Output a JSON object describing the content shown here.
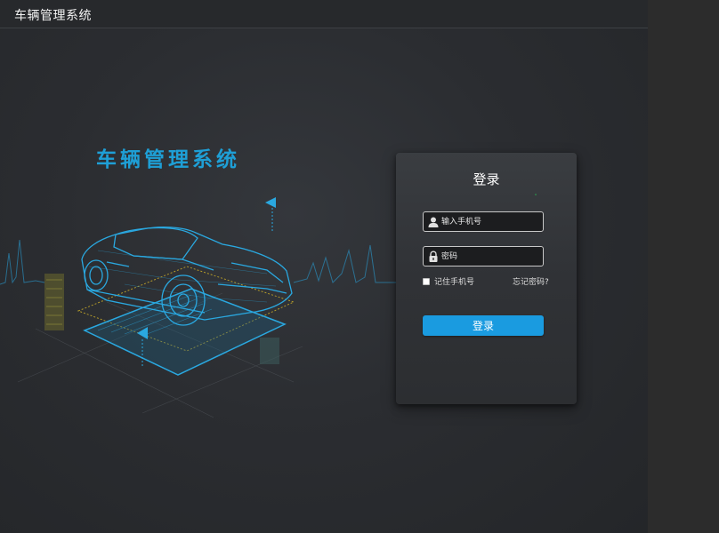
{
  "topbar": {
    "title": "车辆管理系统"
  },
  "hero": {
    "title": "车辆管理系统"
  },
  "login": {
    "title": "登录",
    "phone_placeholder": "输入手机号",
    "password_placeholder": "密码",
    "remember_label": "记住手机号",
    "forgot_label": "忘记密码?",
    "submit_label": "登录"
  },
  "colors": {
    "accent": "#1a9be0",
    "hero_text": "#1e9fd6",
    "background": "#2a2c30",
    "panel": "#34373b",
    "neon": "#2aa8e0",
    "dashed_outline": "#b39a2a"
  },
  "icons": {
    "phone_field": "user-icon",
    "password_field": "lock-icon"
  }
}
